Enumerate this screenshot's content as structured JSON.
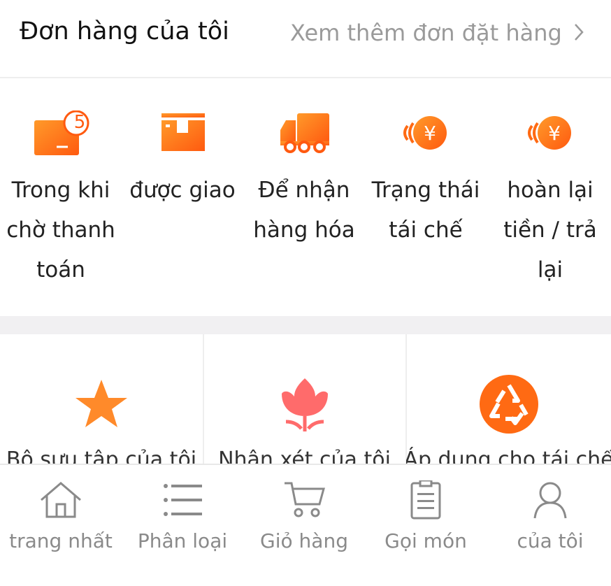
{
  "header": {
    "title": "Đơn hàng của tôi",
    "more_label": "Xem thêm đơn đặt hàng"
  },
  "orders": [
    {
      "label": "Trong khi chờ thanh toán",
      "icon": "wallet-icon",
      "badge": "5"
    },
    {
      "label": "được giao",
      "icon": "package-icon"
    },
    {
      "label": "Để nhận hàng hóa",
      "icon": "truck-icon"
    },
    {
      "label": "Trạng thái tái chế",
      "icon": "refund-yen-icon"
    },
    {
      "label": "hoàn lại tiền / trả lại",
      "icon": "refund-yen-icon"
    }
  ],
  "tools": [
    {
      "label": "Bộ sưu tập của tôi",
      "icon": "star-icon"
    },
    {
      "label": "Nhận xét của tôi",
      "icon": "flower-icon"
    },
    {
      "label": "Áp dụng cho tái chế",
      "icon": "recycle-icon"
    }
  ],
  "tabs": [
    {
      "label": "trang nhất",
      "icon": "home-icon"
    },
    {
      "label": "Phân loại",
      "icon": "list-icon"
    },
    {
      "label": "Giỏ hàng",
      "icon": "cart-icon"
    },
    {
      "label": "Gọi món",
      "icon": "clipboard-icon"
    },
    {
      "label": "của tôi",
      "icon": "user-icon"
    }
  ],
  "colors": {
    "accent": "#ff6a13",
    "accent_light": "#ff8a2a",
    "flower": "#ff6b6b",
    "muted_text": "#9a9a9a",
    "tab_text": "#8a8a8a"
  }
}
